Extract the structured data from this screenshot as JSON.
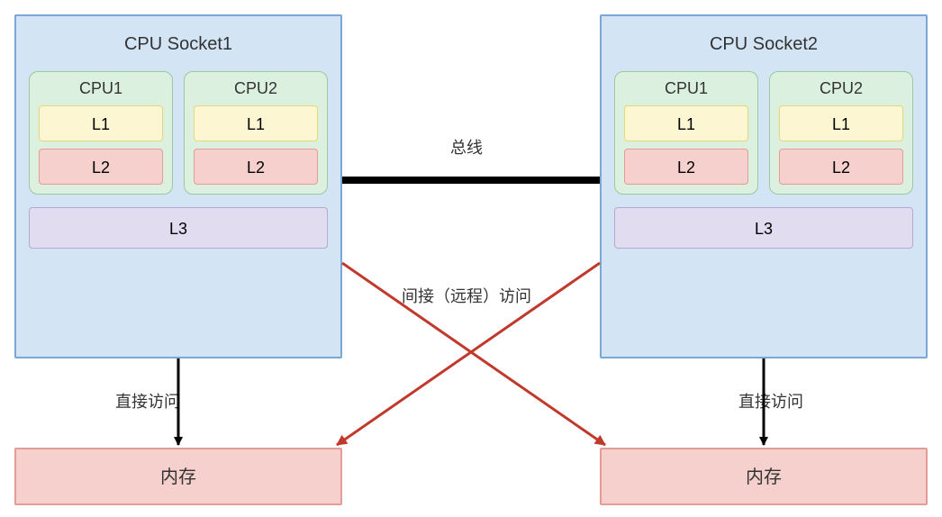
{
  "sockets": [
    {
      "title": "CPU Socket1",
      "cores": [
        {
          "title": "CPU1",
          "l1": "L1",
          "l2": "L2"
        },
        {
          "title": "CPU2",
          "l1": "L1",
          "l2": "L2"
        }
      ],
      "l3": "L3"
    },
    {
      "title": "CPU Socket2",
      "cores": [
        {
          "title": "CPU1",
          "l1": "L1",
          "l2": "L2"
        },
        {
          "title": "CPU2",
          "l1": "L1",
          "l2": "L2"
        }
      ],
      "l3": "L3"
    }
  ],
  "memory": {
    "left": "内存",
    "right": "内存"
  },
  "labels": {
    "bus": "总线",
    "direct_left": "直接访问",
    "direct_right": "直接访问",
    "indirect": "间接（远程）访问"
  },
  "colors": {
    "bus_line": "#000000",
    "indirect_line": "#c0392b",
    "arrow_fill": "#000000"
  }
}
